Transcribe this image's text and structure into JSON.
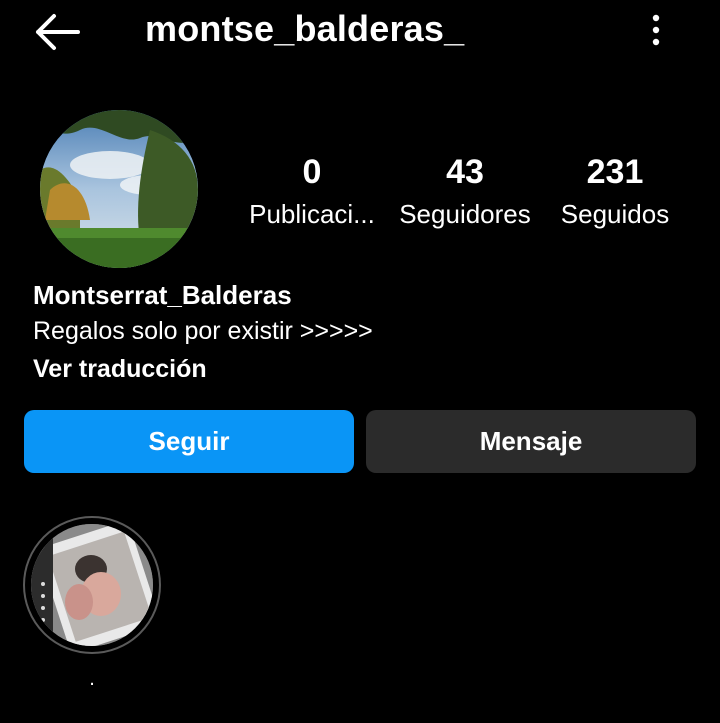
{
  "header": {
    "username": "montse_balderas_",
    "back_icon": "arrow-left-icon",
    "more_icon": "more-vertical-icon"
  },
  "profile": {
    "avatar": "profile-picture",
    "stats": {
      "posts_count": "0",
      "posts_label": "Publicaci...",
      "followers_count": "43",
      "followers_label": "Seguidores",
      "following_count": "231",
      "following_label": "Seguidos"
    },
    "display_name": "Montserrat_Balderas",
    "bio": "Regalos solo por existir >>>>>",
    "translate_link": "Ver traducción"
  },
  "actions": {
    "follow_label": "Seguir",
    "message_label": "Mensaje"
  },
  "highlights": [
    {
      "label": "."
    }
  ],
  "colors": {
    "background": "#000000",
    "follow_button": "#0a95f6",
    "message_button": "#2b2b2b",
    "text": "#ffffff"
  }
}
